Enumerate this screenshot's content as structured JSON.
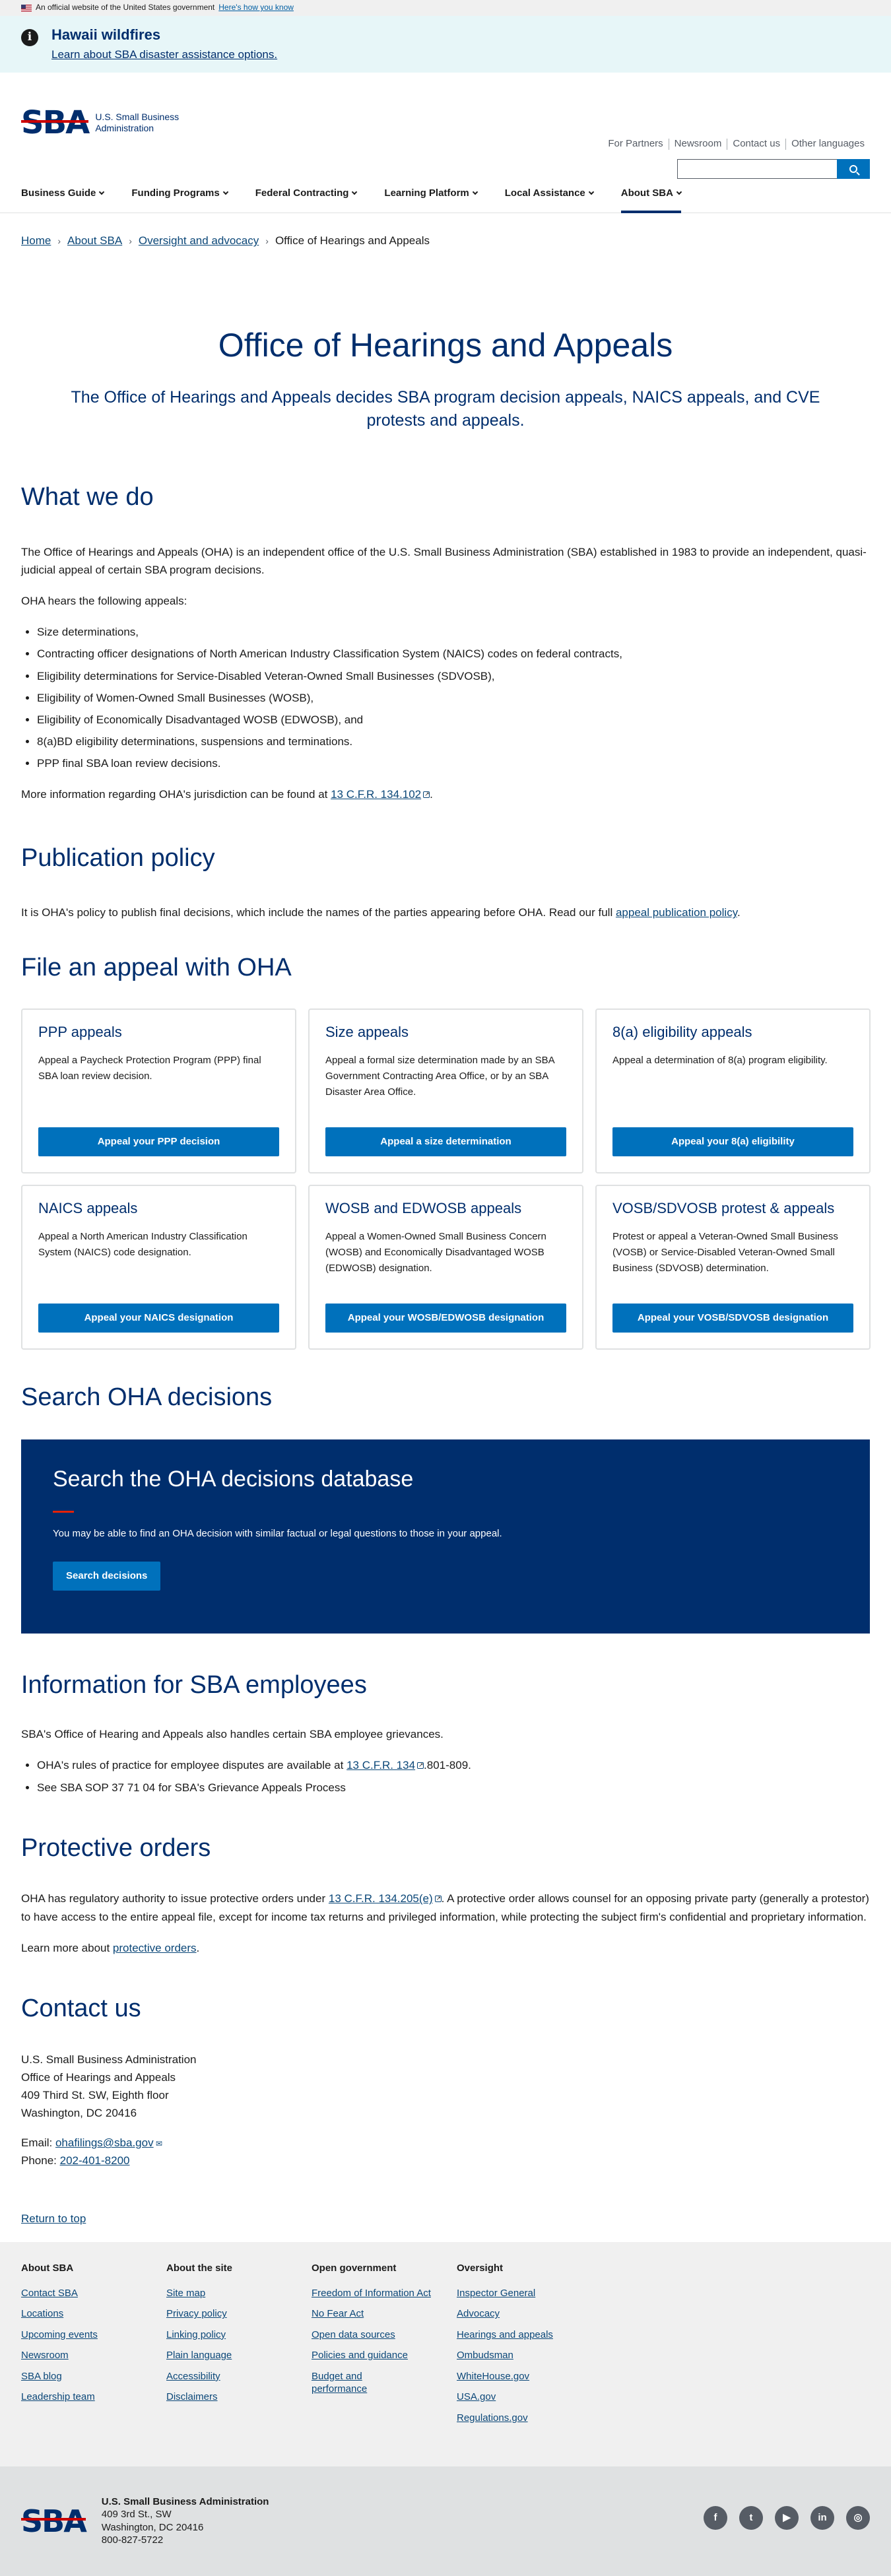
{
  "gov_banner": {
    "text": "An official website of the United States government",
    "link": "Here's how you know"
  },
  "alert": {
    "title": "Hawaii wildfires",
    "link": "Learn about SBA disaster assistance options."
  },
  "logo": {
    "mark": "SBA",
    "line1": "U.S. Small Business",
    "line2": "Administration"
  },
  "util_links": [
    "For Partners",
    "Newsroom",
    "Contact us",
    "Other languages"
  ],
  "search": {
    "placeholder": ""
  },
  "nav": [
    "Business Guide",
    "Funding Programs",
    "Federal Contracting",
    "Learning Platform",
    "Local Assistance",
    "About SBA"
  ],
  "breadcrumb": [
    "Home",
    "About SBA",
    "Oversight and advocacy",
    "Office of Hearings and Appeals"
  ],
  "hero": {
    "title": "Office of Hearings and Appeals",
    "lead": "The Office of Hearings and Appeals decides SBA program decision appeals, NAICS appeals, and CVE protests and appeals."
  },
  "what_we_do": {
    "title": "What we do",
    "p1": "The Office of Hearings and Appeals (OHA) is an independent office of the U.S. Small Business Administration (SBA) established in 1983 to provide an independent, quasi-judicial appeal of certain SBA program decisions.",
    "p2": "OHA hears the following appeals:",
    "items": [
      "Size determinations,",
      "Contracting officer designations of North American Industry Classification System (NAICS) codes on federal contracts,",
      "Eligibility determinations for Service-Disabled Veteran-Owned Small Businesses (SDVOSB),",
      "Eligibility of Women-Owned Small Businesses (WOSB),",
      "Eligibility of Economically Disadvantaged WOSB (EDWOSB), and",
      "8(a)BD eligibility determinations, suspensions and terminations.",
      "PPP final SBA loan review decisions."
    ],
    "p3_pre": "More information regarding OHA's jurisdiction can be found at ",
    "p3_link": "13 C.F.R. 134.102",
    "p3_post": "."
  },
  "publication": {
    "title": "Publication policy",
    "text": "It is OHA's policy to publish final decisions, which include the names of the parties appearing before OHA. Read our full ",
    "link": "appeal publication policy",
    "post": "."
  },
  "file_appeal": {
    "title": "File an appeal with OHA",
    "cards": [
      {
        "title": "PPP appeals",
        "body": "Appeal a Paycheck Protection Program (PPP) final SBA loan review decision.",
        "button": "Appeal your PPP decision"
      },
      {
        "title": "Size appeals",
        "body": "Appeal a formal size determination made by an SBA Government Contracting Area Office, or by an SBA Disaster Area Office.",
        "button": "Appeal a size determination"
      },
      {
        "title": "8(a) eligibility appeals",
        "body": "Appeal a determination of 8(a) program eligibility.",
        "button": "Appeal your 8(a) eligibility"
      },
      {
        "title": "NAICS appeals",
        "body": "Appeal a North American Industry Classification System (NAICS) code designation.",
        "button": "Appeal your NAICS designation"
      },
      {
        "title": "WOSB and EDWOSB appeals",
        "body": "Appeal a Women-Owned Small Business Concern (WOSB) and Economically Disadvantaged WOSB (EDWOSB) designation.",
        "button": "Appeal your WOSB/EDWOSB designation"
      },
      {
        "title": "VOSB/SDVOSB protest & appeals",
        "body": "Protest or appeal a Veteran-Owned Small Business (VOSB) or Service-Disabled Veteran-Owned Small Business (SDVOSB) determination.",
        "button": "Appeal your VOSB/SDVOSB designation"
      }
    ]
  },
  "search_oha": {
    "title": "Search OHA decisions",
    "box_title": "Search the OHA decisions database",
    "box_text": "You may be able to find an OHA decision with similar factual or legal questions to those in your appeal.",
    "button": "Search decisions"
  },
  "employees": {
    "title": "Information for SBA employees",
    "p": "SBA's Office of Hearing and Appeals also handles certain SBA employee grievances.",
    "item1_pre": "OHA's rules of practice for employee disputes are available at ",
    "item1_link": "13 C.F.R. 134",
    "item1_post": ".801-809.",
    "item2": "See SBA SOP 37 71 04 for SBA's Grievance Appeals Process"
  },
  "protective": {
    "title": "Protective orders",
    "p_pre": "OHA has regulatory authority to issue protective orders under ",
    "p_link": "13 C.F.R. 134.205(e)",
    "p_post": ". A protective order allows counsel for an opposing private party (generally a protestor) to have access to the entire appeal file, except for income tax returns and privileged information, while protecting the subject firm's confidential and proprietary information.",
    "p2_pre": "Learn more about ",
    "p2_link": "protective orders",
    "p2_post": "."
  },
  "contact": {
    "title": "Contact us",
    "lines": [
      "U.S. Small Business Administration",
      "Office of Hearings and Appeals",
      "409 Third St. SW, Eighth floor",
      "Washington, DC 20416"
    ],
    "email_label": "Email: ",
    "email": "ohafilings@sba.gov",
    "phone_label": "Phone: ",
    "phone": "202-401-8200"
  },
  "return_top": "Return to top",
  "footer": {
    "cols": [
      {
        "title": "About SBA",
        "links": [
          "Contact SBA",
          "Locations",
          "Upcoming events",
          "Newsroom",
          "SBA blog",
          "Leadership team"
        ]
      },
      {
        "title": "About the site",
        "links": [
          "Site map",
          "Privacy policy",
          "Linking policy",
          "Plain language",
          "Accessibility",
          "Disclaimers"
        ]
      },
      {
        "title": "Open government",
        "links": [
          "Freedom of Information Act",
          "No Fear Act",
          "Open data sources",
          "Policies and guidance",
          "Budget and performance"
        ]
      },
      {
        "title": "Oversight",
        "links": [
          "Inspector General",
          "Advocacy",
          "Hearings and appeals",
          "Ombudsman",
          "WhiteHouse.gov",
          "USA.gov",
          "Regulations.gov"
        ]
      }
    ]
  },
  "identity": {
    "name": "U.S. Small Business Administration",
    "street": "409 3rd St., SW",
    "city": "Washington, DC 20416",
    "phone": "800-827-5722"
  },
  "social": [
    {
      "icon": "facebook-icon",
      "glyph": "f"
    },
    {
      "icon": "twitter-icon",
      "glyph": "t"
    },
    {
      "icon": "youtube-icon",
      "glyph": "▶"
    },
    {
      "icon": "linkedin-icon",
      "glyph": "in"
    },
    {
      "icon": "instagram-icon",
      "glyph": "◎"
    }
  ]
}
